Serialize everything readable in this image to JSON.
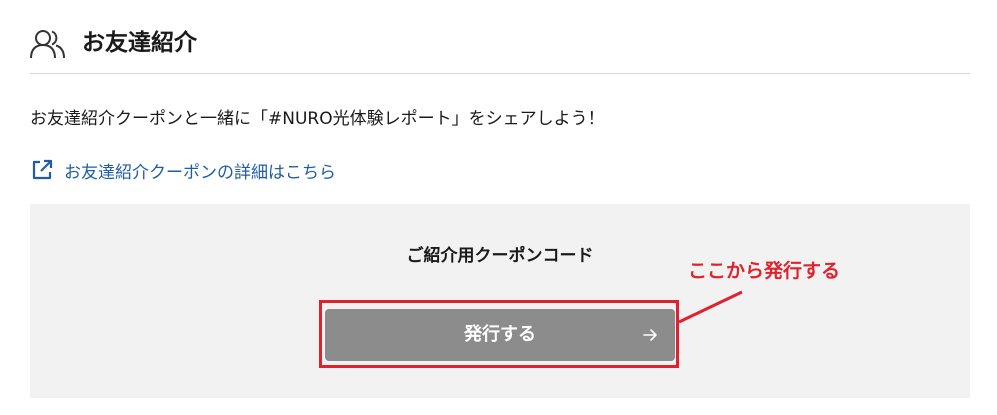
{
  "section": {
    "title": "お友達紹介",
    "icon": "people-icon"
  },
  "intro": {
    "text": "お友達紹介クーポンと一緒に「#NURO光体験レポート」をシェアしよう！"
  },
  "link": {
    "label": "お友達紹介クーポンの詳細はこちら",
    "icon": "external-link-icon",
    "color": "#1f5da8"
  },
  "coupon": {
    "title": "ご紹介用クーポンコード",
    "button_label": "発行する",
    "button_icon": "arrow-right-icon",
    "panel_color": "#f2f2f2",
    "button_color": "#8c8c8c"
  },
  "annotation": {
    "text": "ここから発行する",
    "color": "#e0222d"
  }
}
